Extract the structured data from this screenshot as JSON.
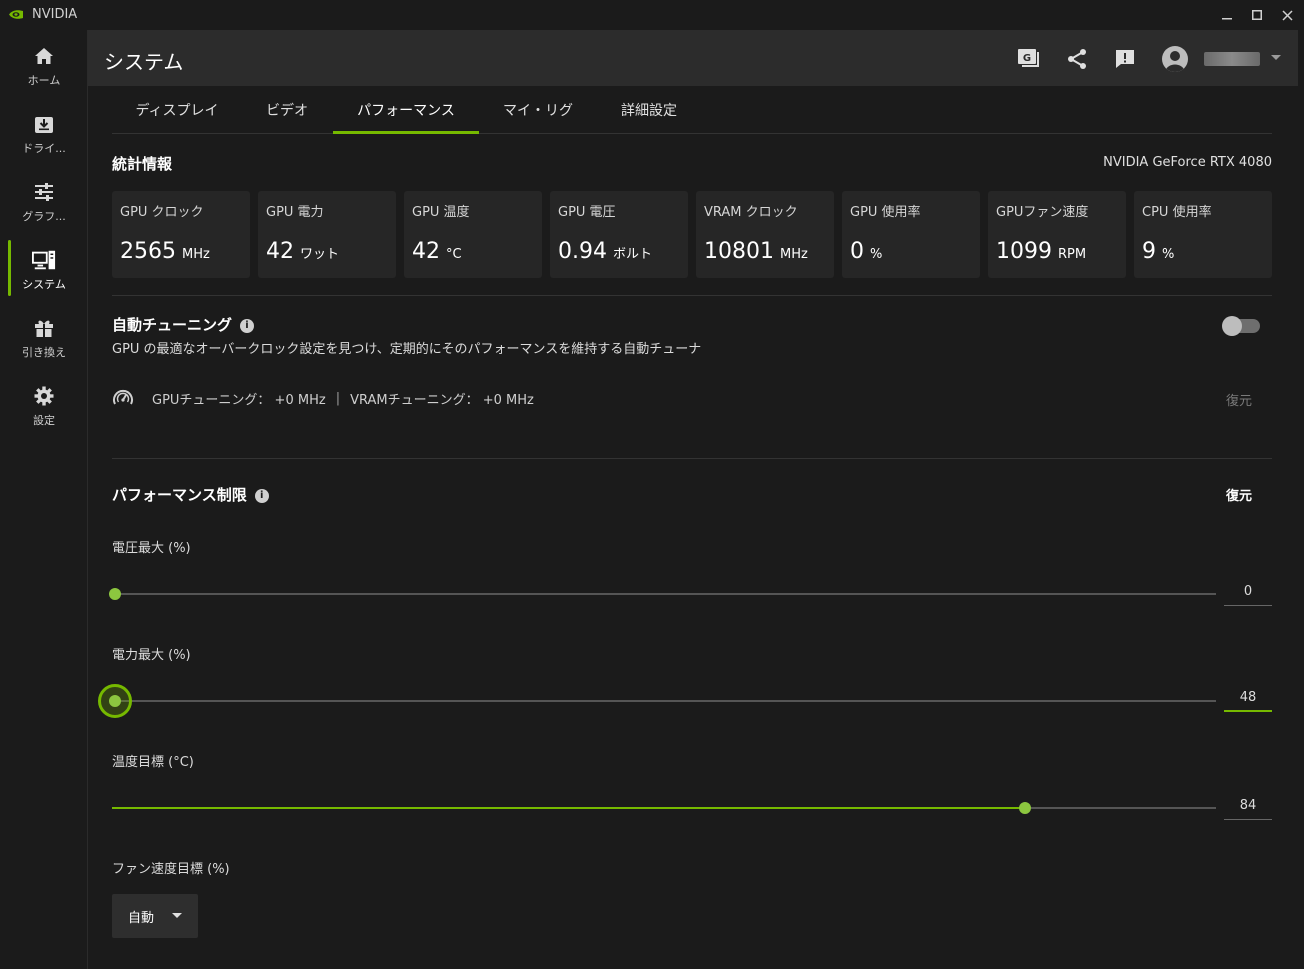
{
  "window": {
    "title": "NVIDIA"
  },
  "colors": {
    "accent": "#76b900",
    "background": "#1b1b1b",
    "card": "#262626",
    "header": "#2c2c2c"
  },
  "nav": {
    "items": [
      {
        "label": "ホーム",
        "icon": "home-icon",
        "active": false
      },
      {
        "label": "ドライ...",
        "icon": "driver-download-icon",
        "active": false
      },
      {
        "label": "グラフ...",
        "icon": "graphics-sliders-icon",
        "active": false
      },
      {
        "label": "システム",
        "icon": "system-monitor-icon",
        "active": true
      },
      {
        "label": "引き換え",
        "icon": "gift-icon",
        "active": false
      },
      {
        "label": "設定",
        "icon": "gear-icon",
        "active": false
      }
    ]
  },
  "header": {
    "title": "システム",
    "icons": [
      "game-filter-icon",
      "share-icon",
      "feedback-icon",
      "user-avatar-icon"
    ]
  },
  "tabs": [
    {
      "label": "ディスプレイ",
      "active": false
    },
    {
      "label": "ビデオ",
      "active": false
    },
    {
      "label": "パフォーマンス",
      "active": true
    },
    {
      "label": "マイ・リグ",
      "active": false
    },
    {
      "label": "詳細設定",
      "active": false
    }
  ],
  "stats": {
    "title": "統計情報",
    "gpu_name": "NVIDIA GeForce RTX 4080",
    "cards": [
      {
        "label": "GPU クロック",
        "value": "2565",
        "unit": "MHz"
      },
      {
        "label": "GPU 電力",
        "value": "42",
        "unit": "ワット"
      },
      {
        "label": "GPU 温度",
        "value": "42",
        "unit": "°C"
      },
      {
        "label": "GPU 電圧",
        "value": "0.94",
        "unit": "ボルト"
      },
      {
        "label": "VRAM クロック",
        "value": "10801",
        "unit": "MHz"
      },
      {
        "label": "GPU 使用率",
        "value": "0",
        "unit": "%"
      },
      {
        "label": "GPUファン速度",
        "value": "1099",
        "unit": "RPM"
      },
      {
        "label": "CPU 使用率",
        "value": "9",
        "unit": "%"
      }
    ]
  },
  "auto_tuning": {
    "title": "自動チューニング",
    "info_glyph": "i",
    "description": "GPU の最適なオーバークロック設定を見つけ、定期的にそのパフォーマンスを維持する自動チューナ",
    "enabled": false,
    "gpu_tuning": "GPUチューニング： +0 MHz",
    "separator": "|",
    "vram_tuning": "VRAMチューニング： +0 MHz",
    "restore": "復元"
  },
  "perf_limits": {
    "title": "パフォーマンス制限",
    "info_glyph": "i",
    "restore": "復元",
    "sliders": [
      {
        "label": "電圧最大 (%)",
        "value": "0",
        "fraction": 0.0,
        "focused": false
      },
      {
        "label": "電力最大 (%)",
        "value": "48",
        "fraction": 0.0,
        "focused": true
      },
      {
        "label": "温度目標 (°C)",
        "value": "84",
        "fraction": 0.824,
        "focused": false
      }
    ],
    "fan": {
      "label": "ファン速度目標 (%)",
      "selected": "自動"
    }
  }
}
